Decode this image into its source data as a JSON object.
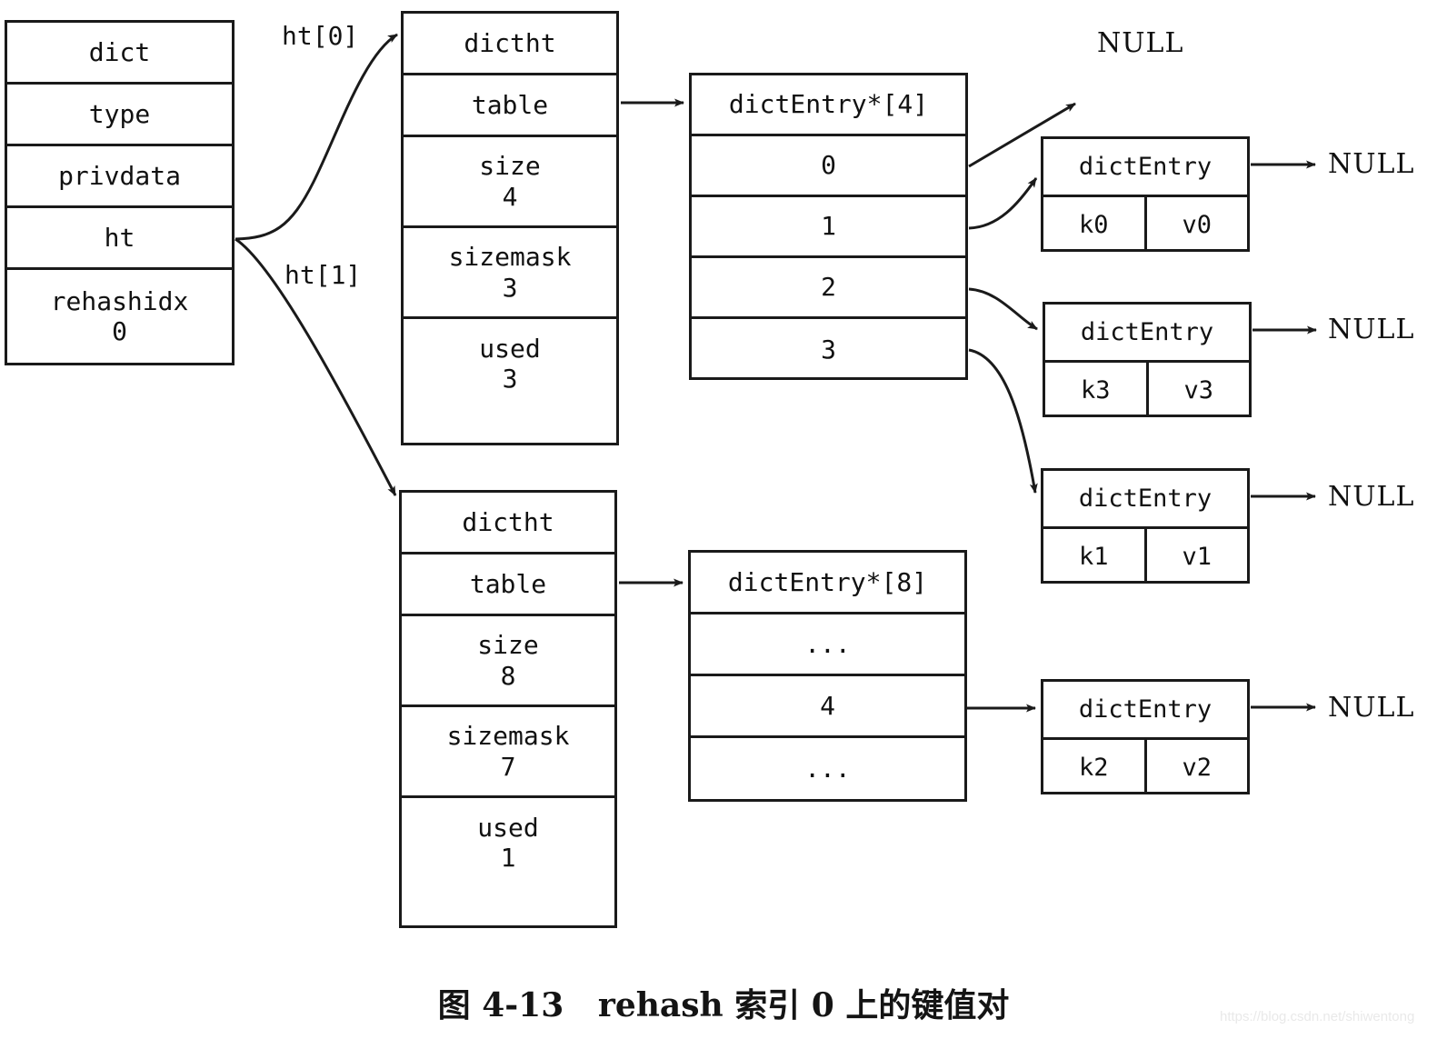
{
  "figure": {
    "caption": "图 4-13   rehash 索引 0 上的键值对",
    "watermark": "https://blog.csdn.net/shiwentong"
  },
  "dict": {
    "title": "dict",
    "fields": [
      {
        "label": "type",
        "value": ""
      },
      {
        "label": "privdata",
        "value": ""
      },
      {
        "label": "ht",
        "value": ""
      },
      {
        "label": "rehashidx",
        "value": "0"
      }
    ]
  },
  "pointer_labels": {
    "ht0": "ht[0]",
    "ht1": "ht[1]"
  },
  "hashtables": [
    {
      "title": "dictht",
      "table_label": "table",
      "size_label": "size",
      "size_value": "4",
      "sizemask_label": "sizemask",
      "sizemask_value": "3",
      "used_label": "used",
      "used_value": "3"
    },
    {
      "title": "dictht",
      "table_label": "table",
      "size_label": "size",
      "size_value": "8",
      "sizemask_label": "sizemask",
      "sizemask_value": "7",
      "used_label": "used",
      "used_value": "1"
    }
  ],
  "bucket_tables": [
    {
      "header": "dictEntry*[4]",
      "buckets": [
        "0",
        "1",
        "2",
        "3"
      ]
    },
    {
      "header": "dictEntry*[8]",
      "buckets": [
        "...",
        "4",
        "..."
      ]
    }
  ],
  "entries": [
    {
      "title": "dictEntry",
      "key": "k0",
      "value": "v0",
      "next": "NULL"
    },
    {
      "title": "dictEntry",
      "key": "k3",
      "value": "v3",
      "next": "NULL"
    },
    {
      "title": "dictEntry",
      "key": "k1",
      "value": "v1",
      "next": "NULL"
    },
    {
      "title": "dictEntry",
      "key": "k2",
      "value": "v2",
      "next": "NULL"
    }
  ],
  "null_top": "NULL"
}
